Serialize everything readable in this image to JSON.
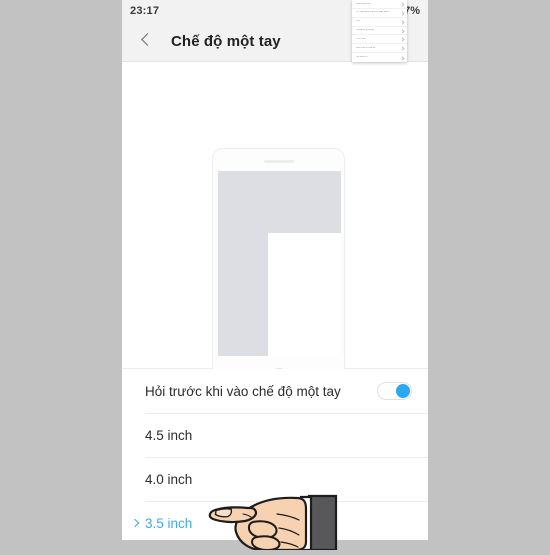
{
  "status_bar": {
    "clock": "23:17",
    "battery": "37%",
    "icons": [
      "more-dots-icon",
      "signal-bars-icon"
    ]
  },
  "action_bar": {
    "back_icon": "back-chevron-icon",
    "title": "Chế độ một tay"
  },
  "illustration": {
    "device_label": "phone-device-illustration",
    "nav_buttons": [
      "recents-icon",
      "home-icon",
      "back-icon"
    ]
  },
  "settings": {
    "rows": [
      {
        "label": "Hỏi trước khi vào chế độ một tay",
        "type": "toggle",
        "toggle_on": true,
        "selected": false
      },
      {
        "label": "4.5 inch",
        "type": "option",
        "selected": false
      },
      {
        "label": "4.0 inch",
        "type": "option",
        "selected": false
      },
      {
        "label": "3.5 inch",
        "type": "option",
        "selected": true
      }
    ]
  },
  "dropdown_menu": {
    "items": [
      {
        "label": "Mở rộng sim"
      },
      {
        "label": "Từ nghĩa & hiển thị bàn thêm"
      },
      {
        "label": "Pin"
      },
      {
        "label": "Khóa ứng dụng"
      },
      {
        "label": "Thư mục"
      },
      {
        "label": "Dọn rác & Cài lại"
      },
      {
        "label": "Về thiết bị"
      }
    ]
  },
  "cursor": {
    "type": "pointing-hand-cursor"
  },
  "colors": {
    "page_background": "#c2c2c3",
    "app_background": "#ffffff",
    "bar_background": "#f2f2f2",
    "accent_blue": "#3fa8f4",
    "toggle_blue": "#2ca7f2",
    "screen_gray": "#dcdee4",
    "divider": "#ededed",
    "text_primary": "#2c2c2c",
    "skin": "#f6d2b0",
    "sleeve": "#58585a"
  }
}
